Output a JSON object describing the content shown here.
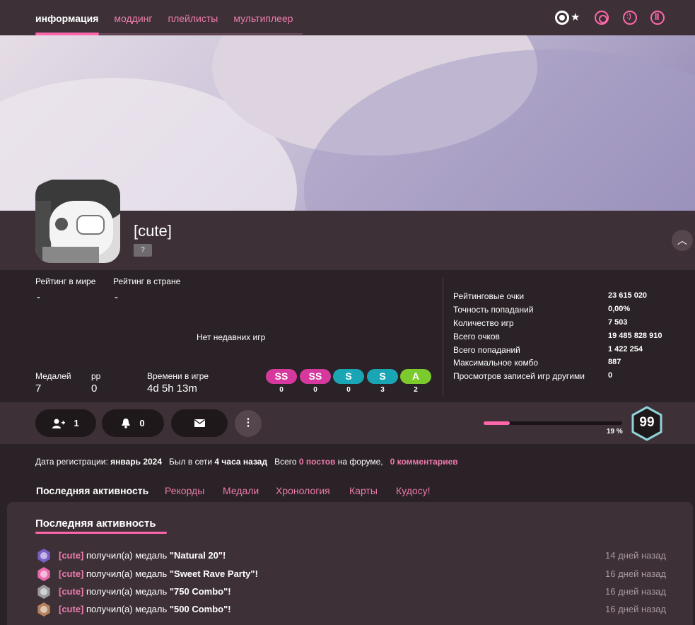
{
  "nav": {
    "tabs": [
      {
        "label": "информация",
        "active": true
      },
      {
        "label": "моддинг"
      },
      {
        "label": "плейлисты"
      },
      {
        "label": "мультиплеер"
      }
    ],
    "modes": [
      "osu-icon",
      "star-icon",
      "taiko-icon",
      "fruits-icon",
      "mania-icon"
    ]
  },
  "profile": {
    "username": "[cute]",
    "badge": "?"
  },
  "ranks": {
    "global_label": "Рейтинг в мире",
    "global_value": "-",
    "country_label": "Рейтинг в стране",
    "country_value": "-",
    "no_recent": "Нет недавних игр"
  },
  "summary": {
    "medals_label": "Медалей",
    "medals_value": "7",
    "pp_label": "pp",
    "pp_value": "0",
    "playtime_label": "Времени в игре",
    "playtime_value": "4d 5h 13m"
  },
  "grades": [
    {
      "label": "SS",
      "count": "0",
      "color": "#d6399e"
    },
    {
      "label": "SS",
      "count": "0",
      "color": "#d6399e"
    },
    {
      "label": "S",
      "count": "0",
      "color": "#1aa5b5"
    },
    {
      "label": "S",
      "count": "3",
      "color": "#1aa5b5"
    },
    {
      "label": "A",
      "count": "2",
      "color": "#7ccb2e"
    }
  ],
  "stats": [
    {
      "label": "Рейтинговые очки",
      "value": "23 615 020"
    },
    {
      "label": "Точность попаданий",
      "value": "0,00%"
    },
    {
      "label": "Количество игр",
      "value": "7 503"
    },
    {
      "label": "Всего очков",
      "value": "19 485 828 910"
    },
    {
      "label": "Всего попаданий",
      "value": "1 422 254"
    },
    {
      "label": "Максимальное комбо",
      "value": "887"
    },
    {
      "label": "Просмотров записей игр другими",
      "value": "0"
    }
  ],
  "actions": {
    "friends_count": "1",
    "subscribers_count": "0"
  },
  "level": {
    "value": "99",
    "progress_label": "19 %",
    "progress": 0.19
  },
  "info": {
    "reg_label": "Дата регистрации:",
    "reg_value": "январь 2024",
    "online_label": "Был в сети",
    "online_value": "4 часа назад",
    "total_label": "Всего",
    "posts_link": "0 постов",
    "forum_text": "на форуме,",
    "comments_link": "0 комментариев"
  },
  "subtabs": [
    "Последняя активность",
    "Рекорды",
    "Медали",
    "Хронология",
    "Карты",
    "Кудосу!"
  ],
  "activity": {
    "title": "Последняя активность",
    "items": [
      {
        "user": "[cute]",
        "text": " получил(а) медаль ",
        "medal": "\"Natural 20\"!",
        "time": "14 дней назад",
        "color": "#7a5fc4"
      },
      {
        "user": "[cute]",
        "text": " получил(а) медаль ",
        "medal": "\"Sweet Rave Party\"!",
        "time": "16 дней назад",
        "color": "#e86bb0"
      },
      {
        "user": "[cute]",
        "text": " получил(а) медаль ",
        "medal": "\"750 Combo\"!",
        "time": "16 дней назад",
        "color": "#9c9a9e"
      },
      {
        "user": "[cute]",
        "text": " получил(а) медаль ",
        "medal": "\"500 Combo\"!",
        "time": "16 дней назад",
        "color": "#b5825c"
      }
    ]
  },
  "colors": {
    "accent": "#ff66aa",
    "link": "#ec7bac",
    "panel": "#3d3137",
    "background": "#2a2226",
    "level_ring": "#8fd3d8"
  }
}
